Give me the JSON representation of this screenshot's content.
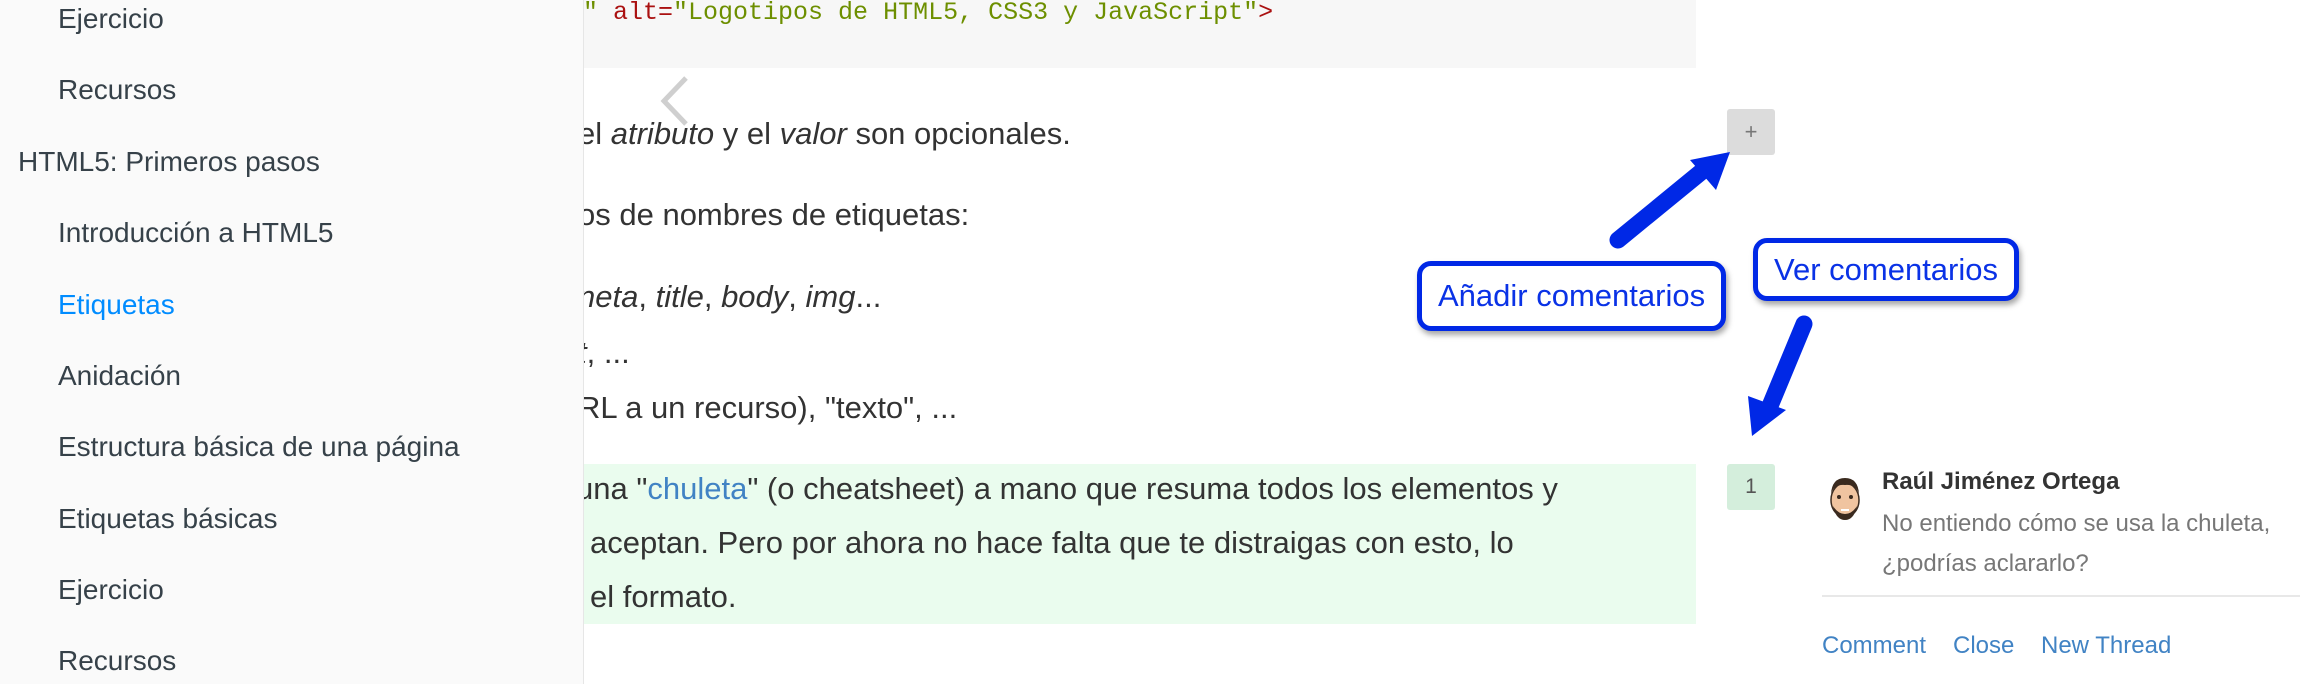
{
  "sidebar": {
    "items": [
      {
        "label": "Ejercicio"
      },
      {
        "label": "Recursos"
      },
      {
        "label": "HTML5: Primeros pasos"
      },
      {
        "label": "Introducción a HTML5"
      },
      {
        "label": "Etiquetas"
      },
      {
        "label": "Anidación"
      },
      {
        "label": "Estructura básica de una página"
      },
      {
        "label": "Etiquetas básicas"
      },
      {
        "label": "Ejercicio"
      },
      {
        "label": "Recursos"
      }
    ],
    "active_color": "#008cff"
  },
  "content": {
    "code": {
      "part1": "\" ",
      "attr": "alt=",
      "value": "\"Logotipos de HTML5, CSS3 y JavaScript\"",
      "close": ">"
    },
    "para1": {
      "a": "el ",
      "b": "atributo",
      "c": " y el ",
      "d": "valor",
      "e": " son opcionales."
    },
    "para2": "os de nombres de etiquetas:",
    "list1": {
      "a": "neta",
      "b": ", ",
      "c": "title",
      "d": ", ",
      "e": "body",
      "f": ", ",
      "g": "img",
      "h": "..."
    },
    "list2": {
      "a": "t",
      "b": ", ..."
    },
    "list3": "RL a un recurso), \"texto\", ...",
    "highlight": {
      "line1_a": "una \"",
      "line1_link": "chuleta",
      "line1_b": "\" (o cheatsheet) a mano que resuma todos los elementos y",
      "line2": "aceptan. Pero por ahora no hace falta que te distraigas con esto, lo",
      "line3": "el formato."
    }
  },
  "comments": {
    "add_label": "+",
    "count": "1",
    "author": "Raúl Jiménez Ortega",
    "text": "No entiendo cómo se usa la chuleta, ¿podrías aclararlo?",
    "actions": {
      "comment": "Comment",
      "close": "Close",
      "new_thread": "New Thread"
    }
  },
  "callouts": {
    "add": "Añadir comentarios",
    "view": "Ver comentarios",
    "color": "#0028e6"
  }
}
